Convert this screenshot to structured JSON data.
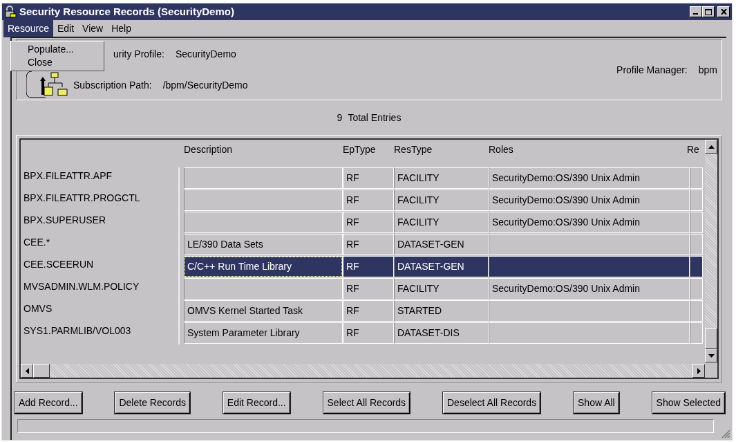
{
  "window": {
    "title": "Security Resource Records (SecurityDemo)"
  },
  "menu": [
    {
      "label": "Resource",
      "selected": true
    },
    {
      "label": "Edit",
      "selected": false
    },
    {
      "label": "View",
      "selected": false
    },
    {
      "label": "Help",
      "selected": false
    }
  ],
  "dropdown": {
    "items": [
      "Populate...",
      "Close"
    ]
  },
  "profile": {
    "security_profile_label": "urity Profile:",
    "security_profile": "SecurityDemo",
    "subscription_path_label": "Subscription Path:",
    "subscription_path": "/bpm/SecurityDemo",
    "profile_manager_label": "Profile Manager:",
    "profile_manager": "bpm"
  },
  "total": {
    "count": "9",
    "label": "Total Entries"
  },
  "table": {
    "columns": [
      "Description",
      "EpType",
      "ResType",
      "Roles",
      "Re"
    ],
    "rows": [
      {
        "name": "BPX.FILEATTR.APF",
        "description": "",
        "ep_type": "RF",
        "res_type": "FACILITY",
        "roles": "SecurityDemo:OS/390 Unix Admin",
        "selected": false
      },
      {
        "name": "BPX.FILEATTR.PROGCTL",
        "description": "",
        "ep_type": "RF",
        "res_type": "FACILITY",
        "roles": "SecurityDemo:OS/390 Unix Admin",
        "selected": false
      },
      {
        "name": "BPX.SUPERUSER",
        "description": "",
        "ep_type": "RF",
        "res_type": "FACILITY",
        "roles": "SecurityDemo:OS/390 Unix Admin",
        "selected": false
      },
      {
        "name": "CEE.*",
        "description": "LE/390 Data Sets",
        "ep_type": "RF",
        "res_type": "DATASET-GEN",
        "roles": "",
        "selected": false
      },
      {
        "name": "CEE.SCEERUN",
        "description": "C/C++ Run Time Library",
        "ep_type": "RF",
        "res_type": "DATASET-GEN",
        "roles": "",
        "selected": true
      },
      {
        "name": "MVSADMIN.WLM.POLICY",
        "description": "",
        "ep_type": "RF",
        "res_type": "FACILITY",
        "roles": "SecurityDemo:OS/390 Unix Admin",
        "selected": false
      },
      {
        "name": "OMVS",
        "description": "OMVS Kernel Started Task",
        "ep_type": "RF",
        "res_type": "STARTED",
        "roles": "",
        "selected": false
      },
      {
        "name": "SYS1.PARMLIB/VOL003",
        "description": "System Parameter Library",
        "ep_type": "RF",
        "res_type": "DATASET-DIS",
        "roles": "",
        "selected": false
      }
    ]
  },
  "buttons": [
    "Add Record...",
    "Delete Records",
    "Edit Record...",
    "Select All Records",
    "Deselect All Records",
    "Show All",
    "Show Selected"
  ]
}
